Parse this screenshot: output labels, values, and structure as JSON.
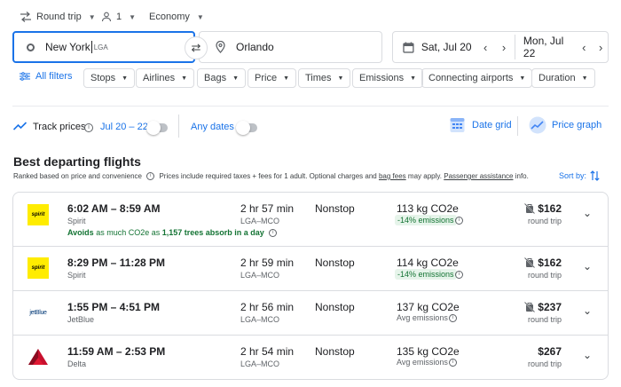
{
  "trip_type": "Round trip",
  "passengers": "1",
  "cabin": "Economy",
  "origin": {
    "city": "New York",
    "code": "LGA"
  },
  "destination": "Orlando",
  "depart_date": "Sat, Jul 20",
  "return_date": "Mon, Jul 22",
  "filters": {
    "all_filters": "All filters",
    "chips": [
      "Stops",
      "Airlines",
      "Bags",
      "Price",
      "Times",
      "Emissions",
      "Connecting airports",
      "Duration"
    ]
  },
  "track": {
    "label": "Track prices",
    "dates": "Jul 20 – 22",
    "any_dates": "Any dates",
    "date_grid": "Date grid",
    "price_graph": "Price graph"
  },
  "results": {
    "heading": "Best departing flights",
    "subtitle_a": "Ranked based on price and convenience",
    "subtitle_b": "Prices include required taxes + fees for 1 adult. Optional charges and",
    "bag_fees": "bag fees",
    "subtitle_c": "may apply.",
    "passenger_assistance": "Passenger assistance",
    "subtitle_d": "info.",
    "sort_by": "Sort by:",
    "flights": [
      {
        "times": "6:02 AM – 8:59 AM",
        "airline": "Spirit",
        "duration": "2 hr 57 min",
        "route": "LGA–MCO",
        "stops": "Nonstop",
        "co2": "113 kg CO2e",
        "emissions": "-14% emissions",
        "price": "$162",
        "price_note": "round trip",
        "avoid_a": "Avoids",
        "avoid_b": "as much CO2e as",
        "avoid_c": "1,157 trees absorb in a day"
      },
      {
        "times": "8:29 PM – 11:28 PM",
        "airline": "Spirit",
        "duration": "2 hr 59 min",
        "route": "LGA–MCO",
        "stops": "Nonstop",
        "co2": "114 kg CO2e",
        "emissions": "-14% emissions",
        "price": "$162",
        "price_note": "round trip"
      },
      {
        "times": "1:55 PM – 4:51 PM",
        "airline": "JetBlue",
        "duration": "2 hr 56 min",
        "route": "LGA–MCO",
        "stops": "Nonstop",
        "co2": "137 kg CO2e",
        "emissions": "Avg emissions",
        "price": "$237",
        "price_note": "round trip"
      },
      {
        "times": "11:59 AM – 2:53 PM",
        "airline": "Delta",
        "duration": "2 hr 54 min",
        "route": "LGA–MCO",
        "stops": "Nonstop",
        "co2": "135 kg CO2e",
        "emissions": "Avg emissions",
        "price": "$267",
        "price_note": "round trip"
      }
    ]
  },
  "logos": {
    "spirit": "spirit",
    "jetblue": "jetBlue"
  },
  "colors": {
    "accent": "#1a73e8",
    "spirit_yellow": "#ffec00",
    "delta_red": "#c8102e",
    "jetblue_navy": "#003876",
    "green": "#137333"
  }
}
